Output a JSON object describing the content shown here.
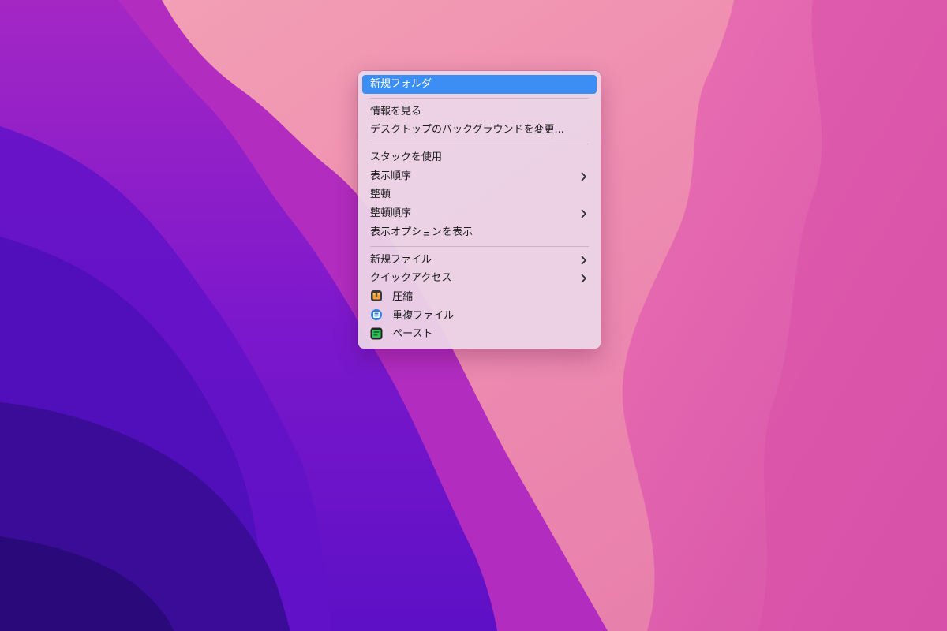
{
  "context_menu": {
    "items": [
      {
        "label": "新規フォルダ"
      },
      {
        "label": "情報を見る"
      },
      {
        "label": "デスクトップのバックグラウンドを変更..."
      },
      {
        "label": "スタックを使用"
      },
      {
        "label": "表示順序"
      },
      {
        "label": "整頓"
      },
      {
        "label": "整頓順序"
      },
      {
        "label": "表示オプションを表示"
      },
      {
        "label": "新規ファイル"
      },
      {
        "label": "クイックアクセス"
      },
      {
        "label": "圧縮",
        "icon": "compress-app-icon"
      },
      {
        "label": "重複ファイル",
        "icon": "duplicate-files-app-icon"
      },
      {
        "label": "ペースト",
        "icon": "paste-app-icon"
      }
    ]
  },
  "colors": {
    "highlight": "#3c8ef5",
    "menu_background": "#ecd6e8",
    "wallpaper_pink": "#ee8fb0",
    "wallpaper_purple": "#5b12c8"
  }
}
